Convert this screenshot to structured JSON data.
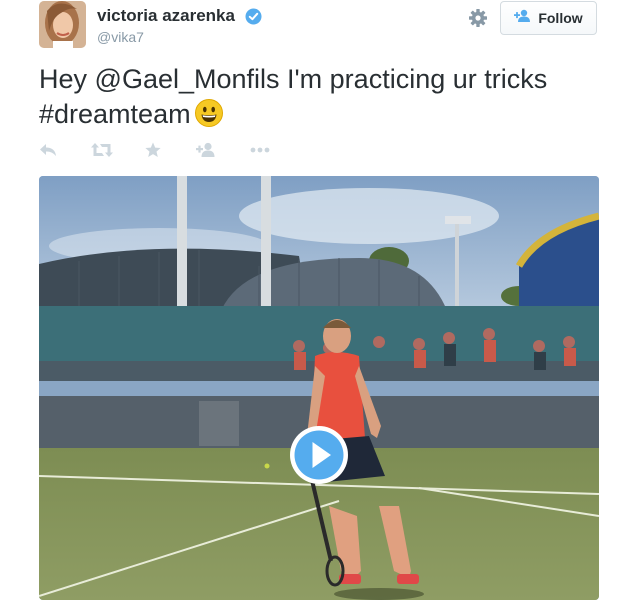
{
  "user": {
    "name": "victoria azarenka",
    "handle": "@vika7",
    "verified": true
  },
  "header": {
    "follow_label": "Follow",
    "settings_icon": "gear-icon"
  },
  "tweet": {
    "prefix": "Hey ",
    "mention": "@Gael_Monfils",
    "middle": " I'm practicing ur tricks ",
    "hashtag": "#dreamteam",
    "emoji": "grinning-face"
  },
  "actions": [
    "reply-icon",
    "retweet-icon",
    "favorite-icon",
    "follow-icon",
    "more-icon"
  ],
  "media": {
    "type": "video",
    "play_icon": "play-icon"
  },
  "colors": {
    "link": "#292f33",
    "muted": "#8899a6",
    "verified": "#55acee",
    "action_icons": "#ccd6dd"
  }
}
